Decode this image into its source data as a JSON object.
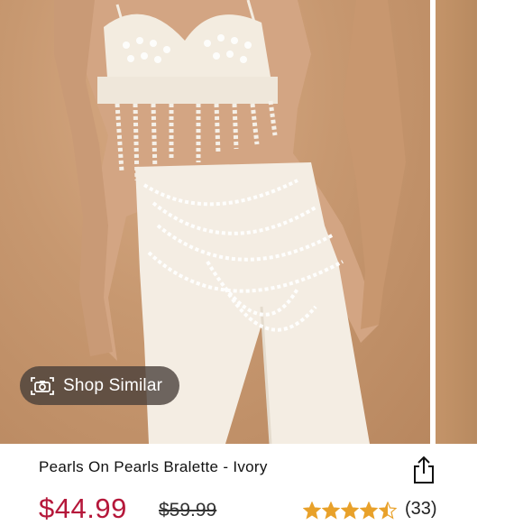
{
  "product": {
    "title": "Pearls On Pearls Bralette - Ivory",
    "price": "$44.99",
    "original_price": "$59.99",
    "rating": 4.5,
    "reviews": "(33)",
    "accent_color": "#b5173a",
    "star_color": "#e8a12a"
  },
  "image_overlay": {
    "shop_similar_label": "Shop Similar",
    "icon": "camera-scan-icon"
  },
  "actions": {
    "share_icon": "share-icon"
  }
}
